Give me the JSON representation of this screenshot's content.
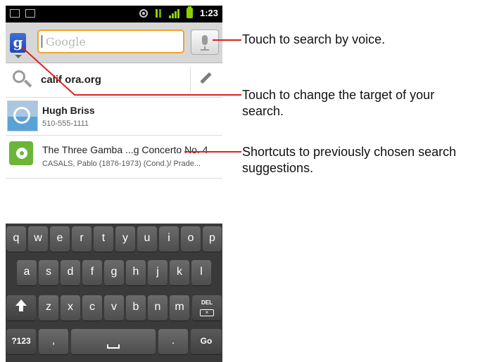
{
  "status_bar": {
    "time": "1:23",
    "icons": [
      "gmail-icon",
      "calendar-icon",
      "gps-icon",
      "data-icon",
      "signal-icon",
      "battery-icon"
    ]
  },
  "search_bar": {
    "source_badge": "g",
    "placeholder": "Google",
    "mic_icon": "mic-icon"
  },
  "suggestions": [
    {
      "type": "query",
      "text": "calif ora.org",
      "icon": "search-icon",
      "action_icon": "pencil-icon"
    },
    {
      "type": "contact",
      "title": "Hugh Briss",
      "subtitle": "510-555-1111",
      "icon": "contact-photo"
    },
    {
      "type": "music",
      "title": "The Three Gamba ...g Concerto No. 4",
      "subtitle": "CASALS, Pablo (1876-1973) (Cond.)/ Prade...",
      "icon": "music-app-icon"
    }
  ],
  "keyboard": {
    "row1": [
      "q",
      "w",
      "e",
      "r",
      "t",
      "y",
      "u",
      "i",
      "o",
      "p"
    ],
    "row2": [
      "a",
      "s",
      "d",
      "f",
      "g",
      "h",
      "j",
      "k",
      "l"
    ],
    "row3": [
      "z",
      "x",
      "c",
      "v",
      "b",
      "n",
      "m"
    ],
    "del_label": "DEL",
    "symbols_label": "?123",
    "comma_label": ",",
    "period_label": ".",
    "go_label": "Go"
  },
  "callouts": {
    "voice": "Touch to search by voice.",
    "target_line1": "Touch to change the target of your",
    "target_line2": "search.",
    "shortcuts_line1": "Shortcuts to previously chosen search",
    "shortcuts_line2": "suggestions."
  },
  "colors": {
    "callout_line": "#e02020",
    "input_focus": "#f3a22b",
    "status_green": "#8bd100"
  }
}
